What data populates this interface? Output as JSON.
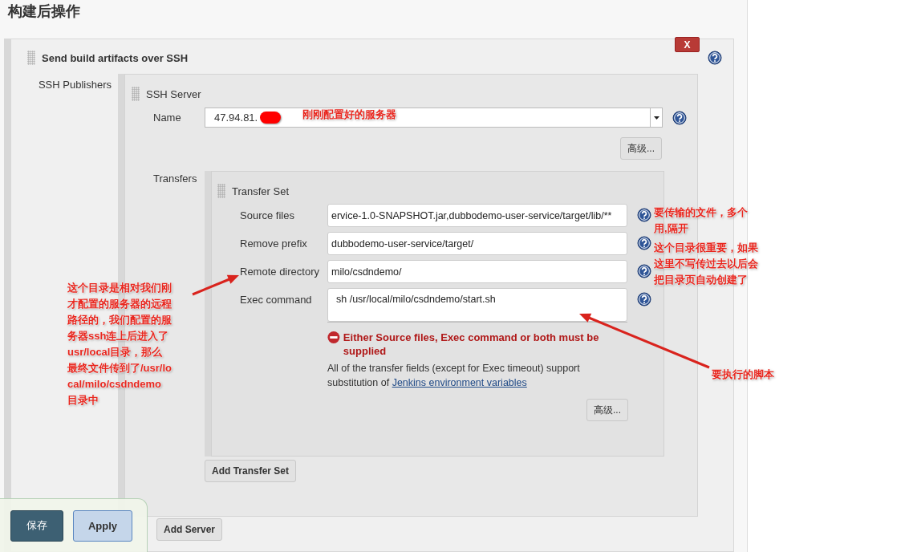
{
  "heading": "构建后操作",
  "step": {
    "title": "Send build artifacts over SSH",
    "delete_button": "X",
    "publishers_label": "SSH Publishers",
    "server": {
      "title": "SSH Server",
      "name_label": "Name",
      "name_value": "47.94.81.",
      "advanced_button": "高级...",
      "transfers_label": "Transfers",
      "transfer_set": {
        "title": "Transfer Set",
        "fields": [
          {
            "label": "Source files",
            "value": "ervice-1.0-SNAPSHOT.jar,dubbodemo-user-service/target/lib/**",
            "kind": "input"
          },
          {
            "label": "Remove prefix",
            "value": "dubbodemo-user-service/target/",
            "kind": "input"
          },
          {
            "label": "Remote directory",
            "value": "milo/csdndemo/",
            "kind": "input"
          },
          {
            "label": "Exec command",
            "value": "sh /usr/local/milo/csdndemo/start.sh",
            "kind": "textarea"
          }
        ],
        "error": "Either Source files, Exec command or both must be supplied",
        "note": "All of the transfer fields (except for Exec timeout) support substitution of",
        "note_link": "Jenkins environment variables",
        "advanced_button": "高级..."
      },
      "add_transfer_set_button": "Add Transfer Set"
    },
    "add_server_button": "Add Server"
  },
  "save_bar": {
    "buttons": [
      {
        "label": "保存",
        "kind": "primary"
      },
      {
        "label": "Apply",
        "kind": "secondary"
      }
    ]
  },
  "annotations": [
    {
      "text": "刚刚配置好的服务器"
    },
    {
      "text": "要传输的文件，多个用,隔开"
    },
    {
      "text": "这个目录很重要，如果这里不写传过去以后会把目录页自动创建了"
    },
    {
      "text": "这个目录是相对我们刚才配置的服务器的远程路径的，我们配置的服务器ssh连上后进入了usr/local目录，那么最终文件传到了/usr/local/milo/csdndemo目录中"
    },
    {
      "text": "要执行的脚本"
    }
  ]
}
